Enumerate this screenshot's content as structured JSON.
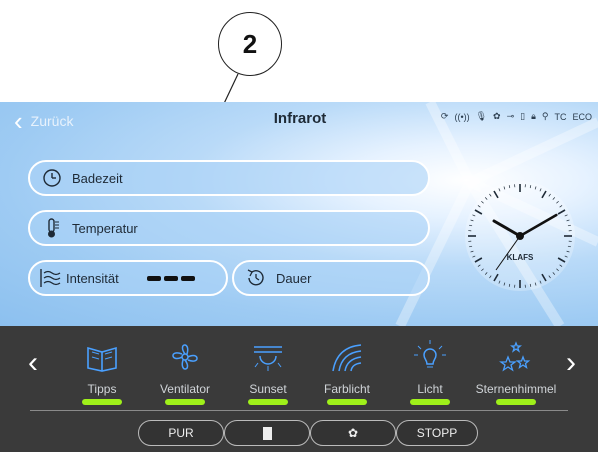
{
  "callout": {
    "number": "2"
  },
  "header": {
    "back_label": "Zurück",
    "title": "Infrarot",
    "tc": "TC",
    "eco": "ECO"
  },
  "controls": {
    "badezeit": "Badezeit",
    "temperatur": "Temperatur",
    "intensitaet": "Intensität",
    "dauer": "Dauer"
  },
  "clock": {
    "brand": "KLAFS",
    "hour_hand_deg": 300,
    "minute_hand_deg": 60
  },
  "functions": [
    {
      "label": "Tipps",
      "icon": "book-icon"
    },
    {
      "label": "Ventilator",
      "icon": "fan-icon"
    },
    {
      "label": "Sunset",
      "icon": "sunset-icon"
    },
    {
      "label": "Farblicht",
      "icon": "rainbow-icon"
    },
    {
      "label": "Licht",
      "icon": "bulb-icon"
    },
    {
      "label": "Sternenhimmel",
      "icon": "stars-icon"
    }
  ],
  "bottom_buttons": {
    "pur": "PUR",
    "stopp": "STOPP"
  },
  "colors": {
    "accent_green": "#9ff01a",
    "bar_bg": "#3a3a3a",
    "screen_blue": "#9ecbf3"
  }
}
